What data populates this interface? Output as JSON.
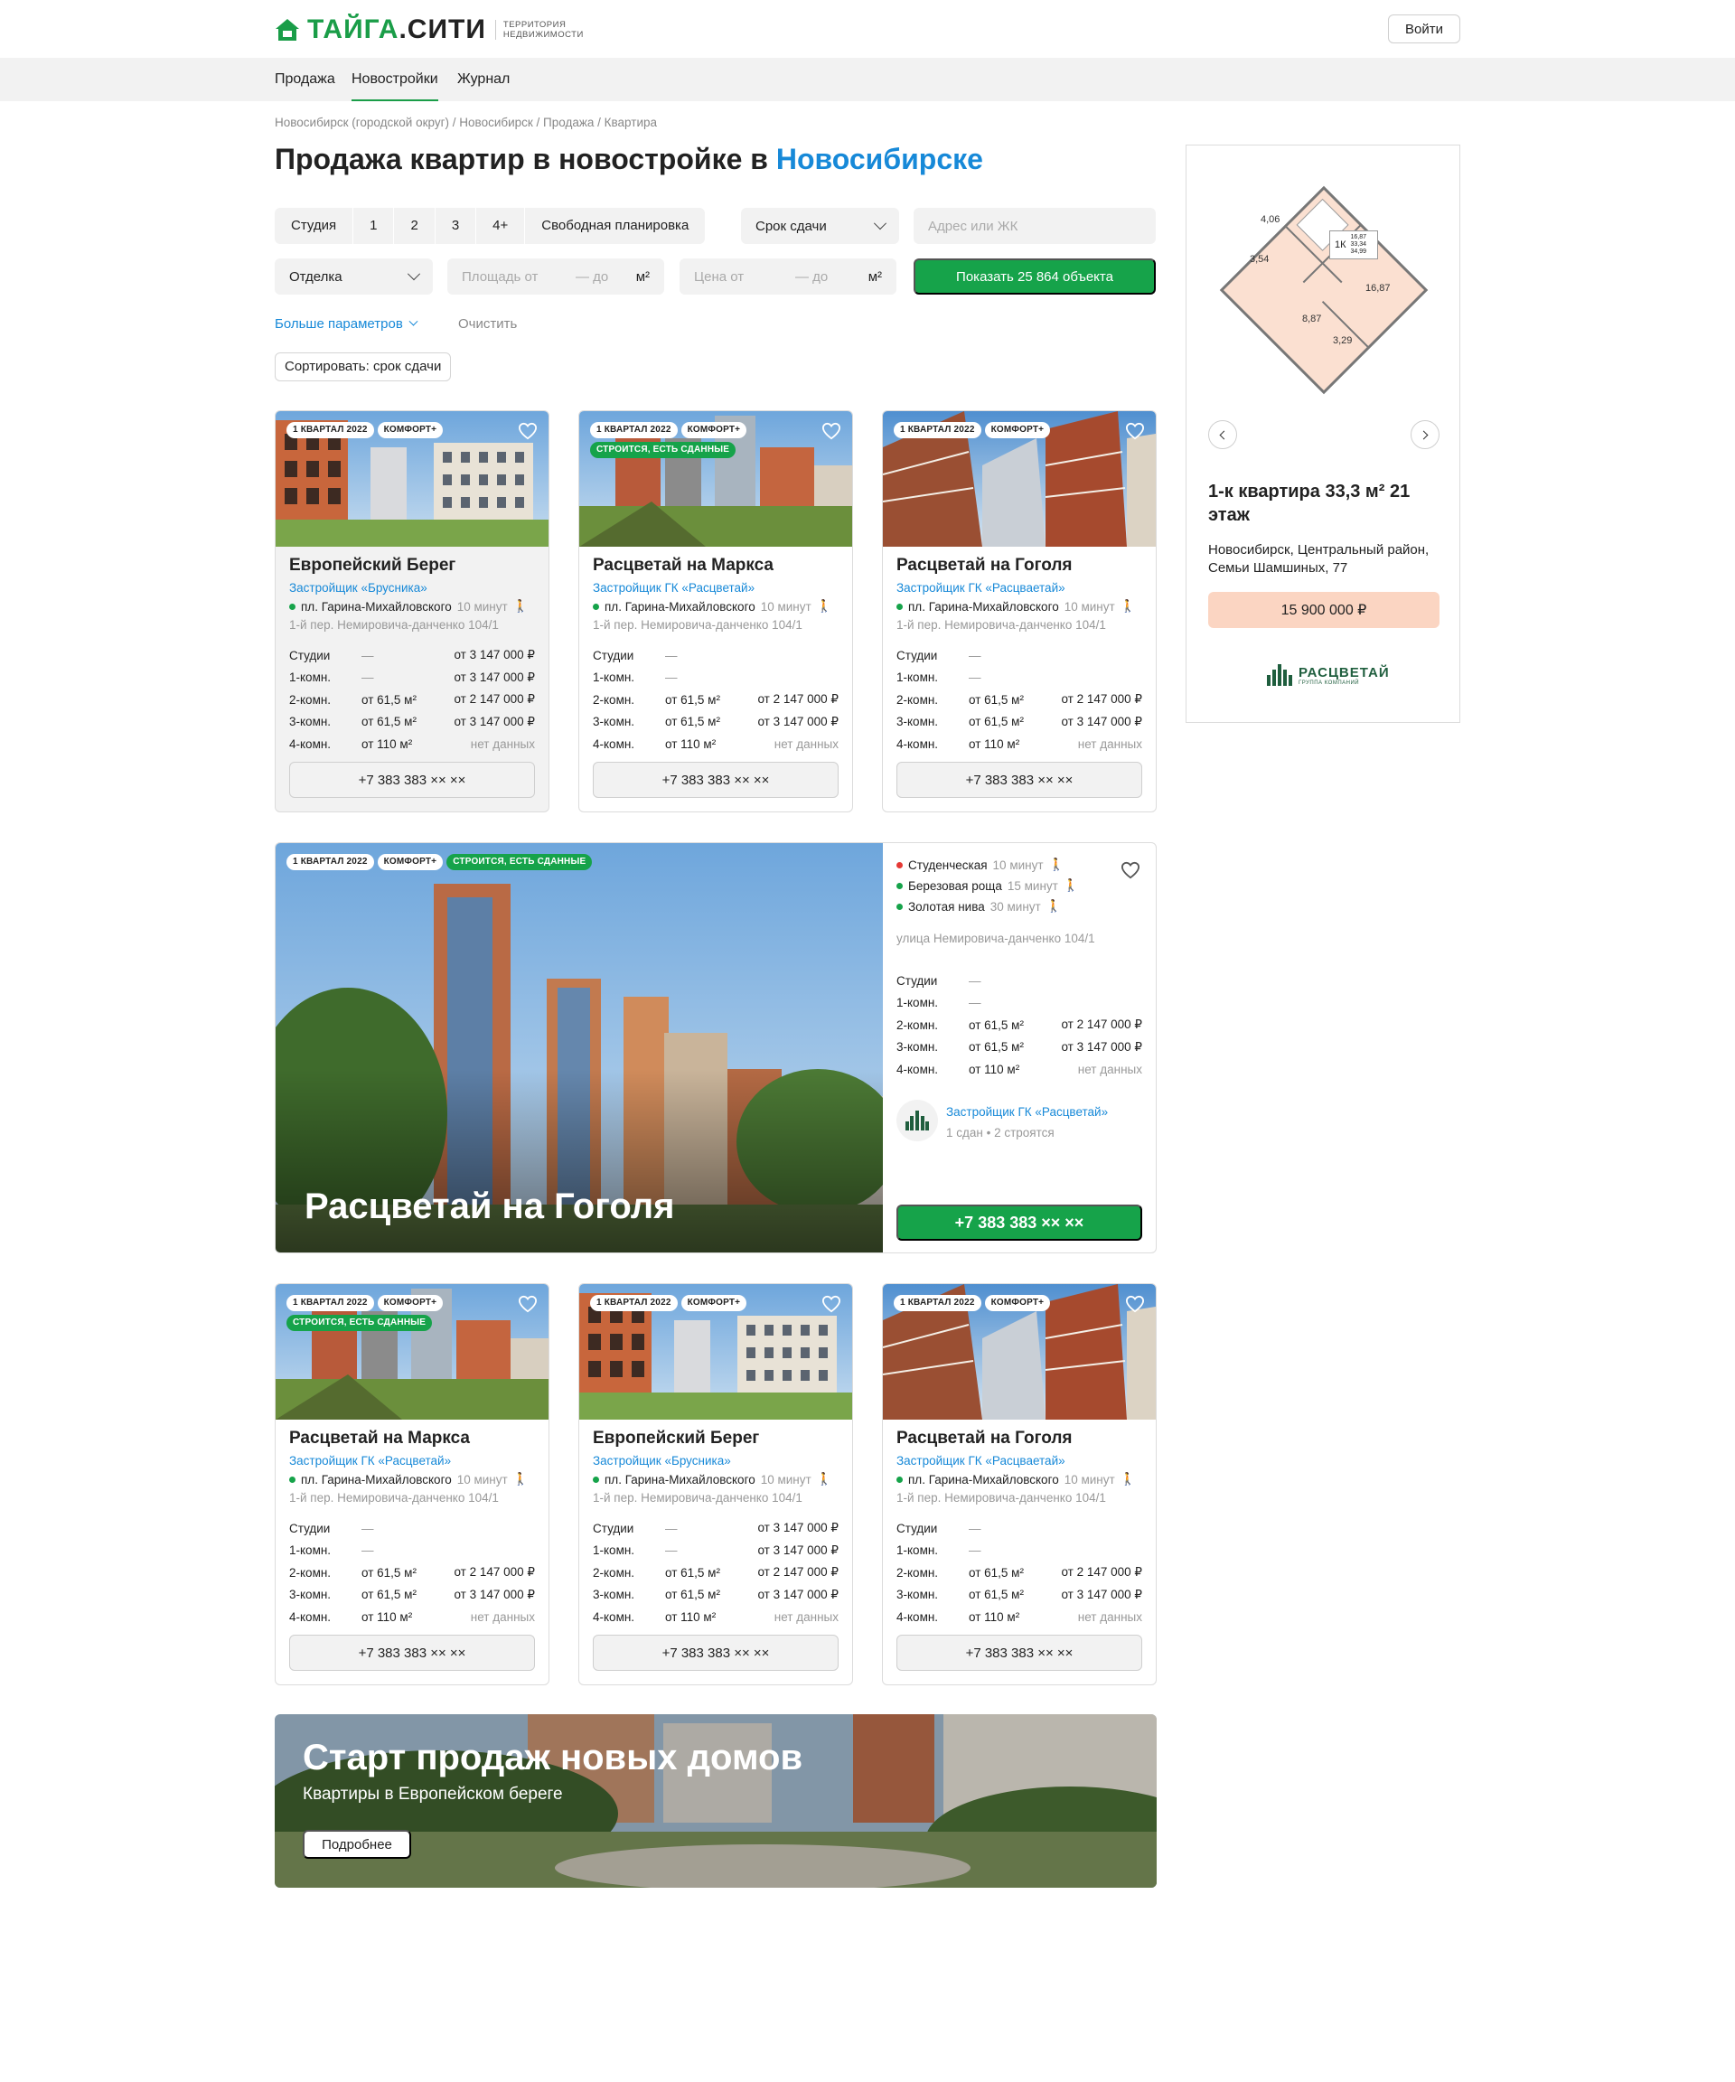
{
  "header": {
    "logo_main": "ТАЙГА",
    "logo_dot": ".СИТИ",
    "logo_tagline_1": "ТЕРРИТОРИЯ",
    "logo_tagline_2": "НЕДВИЖИМОСТИ",
    "login_label": "Войти",
    "brand_color": "#1a9d48"
  },
  "nav": {
    "items": [
      {
        "label": "Продажа",
        "active": false
      },
      {
        "label": "Новостройки",
        "active": true
      },
      {
        "label": "Журнал",
        "active": false
      }
    ]
  },
  "breadcrumb": "Новосибирск (городской округ) / Новосибирск / Продажа / Квартира",
  "title": {
    "prefix": "Продажа квартир в новостройке в",
    "city": "Новосибирске"
  },
  "filters": {
    "rooms": [
      "Студия",
      "1",
      "2",
      "3",
      "4+",
      "Свободная планировка"
    ],
    "deadline": "Срок сдачи",
    "address_placeholder": "Адрес или ЖК",
    "finish": "Отделка",
    "area_from": "Площадь от",
    "area_to": "— до",
    "area_unit": "м²",
    "price_from": "Цена от",
    "price_to": "— до",
    "price_unit": "м²",
    "show_button": "Показать 25 864 объекта",
    "more_params": "Больше параметров",
    "clear": "Очистить",
    "sort": "Сортировать: срок сдачи"
  },
  "cards": [
    {
      "badges": [
        "1 КВАРТАЛ 2022",
        "КОМФОРТ+"
      ],
      "green_badge": "",
      "title": "Европейский Берег",
      "developer": "Застройщик «Брусника»",
      "metro": "пл. Гарина-Михайловского",
      "walk": "10 минут",
      "address": "1-й пер. Немировича-данченко 104/1",
      "rows": [
        {
          "type": "Студии",
          "area": "—",
          "price": "от 3 147 000 ₽"
        },
        {
          "type": "1-комн.",
          "area": "—",
          "price": "от 3 147 000 ₽"
        },
        {
          "type": "2-комн.",
          "area": "от 61,5 м²",
          "price": "от 2 147 000 ₽"
        },
        {
          "type": "3-комн.",
          "area": "от 61,5 м²",
          "price": "от 3 147 000 ₽"
        },
        {
          "type": "4-комн.",
          "area": "от 110 м²",
          "price": "нет данных"
        }
      ],
      "phone": "+7 383 383 ×× ××"
    },
    {
      "badges": [
        "1 КВАРТАЛ 2022",
        "КОМФОРТ+"
      ],
      "green_badge": "СТРОИТСЯ, ЕСТЬ СДАННЫЕ",
      "title": "Расцветай на Маркса",
      "developer": "Застройщик ГК «Расцветай»",
      "metro": "пл. Гарина-Михайловского",
      "walk": "10 минут",
      "address": "1-й пер. Немировича-данченко 104/1",
      "rows": [
        {
          "type": "Студии",
          "area": "—",
          "price": ""
        },
        {
          "type": "1-комн.",
          "area": "—",
          "price": ""
        },
        {
          "type": "2-комн.",
          "area": "от 61,5 м²",
          "price": "от 2 147 000 ₽"
        },
        {
          "type": "3-комн.",
          "area": "от 61,5 м²",
          "price": "от 3 147 000 ₽"
        },
        {
          "type": "4-комн.",
          "area": "от 110 м²",
          "price": "нет данных"
        }
      ],
      "phone": "+7 383 383 ×× ××"
    },
    {
      "badges": [
        "1 КВАРТАЛ 2022",
        "КОМФОРТ+"
      ],
      "green_badge": "",
      "title": "Расцветай на Гоголя",
      "developer": "Застройщик ГК «Расцваетай»",
      "metro": "пл. Гарина-Михайловского",
      "walk": "10 минут",
      "address": "1-й пер. Немировича-данченко 104/1",
      "rows": [
        {
          "type": "Студии",
          "area": "—",
          "price": ""
        },
        {
          "type": "1-комн.",
          "area": "—",
          "price": ""
        },
        {
          "type": "2-комн.",
          "area": "от 61,5 м²",
          "price": "от 2 147 000 ₽"
        },
        {
          "type": "3-комн.",
          "area": "от 61,5 м²",
          "price": "от 3 147 000 ₽"
        },
        {
          "type": "4-комн.",
          "area": "от 110 м²",
          "price": "нет данных"
        }
      ],
      "phone": "+7 383 383 ×× ××"
    },
    {
      "badges": [
        "1 КВАРТАЛ 2022",
        "КОМФОРТ+"
      ],
      "green_badge": "СТРОИТСЯ, ЕСТЬ СДАННЫЕ",
      "title": "Расцветай на Маркса",
      "developer": "Застройщик ГК «Расцветай»",
      "metro": "пл. Гарина-Михайловского",
      "walk": "10 минут",
      "address": "1-й пер. Немировича-данченко 104/1",
      "rows": [
        {
          "type": "Студии",
          "area": "—",
          "price": ""
        },
        {
          "type": "1-комн.",
          "area": "—",
          "price": ""
        },
        {
          "type": "2-комн.",
          "area": "от 61,5 м²",
          "price": "от 2 147 000 ₽"
        },
        {
          "type": "3-комн.",
          "area": "от 61,5 м²",
          "price": "от 3 147 000 ₽"
        },
        {
          "type": "4-комн.",
          "area": "от 110 м²",
          "price": "нет данных"
        }
      ],
      "phone": "+7 383 383 ×× ××"
    },
    {
      "badges": [
        "1 КВАРТАЛ 2022",
        "КОМФОРТ+"
      ],
      "green_badge": "",
      "title": "Европейский Берег",
      "developer": "Застройщик «Брусника»",
      "metro": "пл. Гарина-Михайловского",
      "walk": "10 минут",
      "address": "1-й пер. Немировича-данченко 104/1",
      "rows": [
        {
          "type": "Студии",
          "area": "—",
          "price": "от 3 147 000 ₽"
        },
        {
          "type": "1-комн.",
          "area": "—",
          "price": "от 3 147 000 ₽"
        },
        {
          "type": "2-комн.",
          "area": "от 61,5 м²",
          "price": "от 2 147 000 ₽"
        },
        {
          "type": "3-комн.",
          "area": "от 61,5 м²",
          "price": "от 3 147 000 ₽"
        },
        {
          "type": "4-комн.",
          "area": "от 110 м²",
          "price": "нет данных"
        }
      ],
      "phone": "+7 383 383 ×× ××"
    },
    {
      "badges": [
        "1 КВАРТАЛ 2022",
        "КОМФОРТ+"
      ],
      "green_badge": "",
      "title": "Расцветай на Гоголя",
      "developer": "Застройщик ГК «Расцваетай»",
      "metro": "пл. Гарина-Михайловского",
      "walk": "10 минут",
      "address": "1-й пер. Немировича-данченко 104/1",
      "rows": [
        {
          "type": "Студии",
          "area": "—",
          "price": ""
        },
        {
          "type": "1-комн.",
          "area": "—",
          "price": ""
        },
        {
          "type": "2-комн.",
          "area": "от 61,5 м²",
          "price": "от 2 147 000 ₽"
        },
        {
          "type": "3-комн.",
          "area": "от 61,5 м²",
          "price": "от 3 147 000 ₽"
        },
        {
          "type": "4-комн.",
          "area": "от 110 м²",
          "price": "нет данных"
        }
      ],
      "phone": "+7 383 383 ×× ××"
    }
  ],
  "feature": {
    "badges": [
      "1 КВАРТАЛ 2022",
      "КОМФОРТ+"
    ],
    "green_badge": "СТРОИТСЯ, ЕСТЬ СДАННЫЕ",
    "title": "Расцветай на Гоголя",
    "metros": [
      {
        "name": "Студенческая",
        "walk": "10 минут",
        "line": "red"
      },
      {
        "name": "Березовая роща",
        "walk": "15 минут",
        "line": "green"
      },
      {
        "name": "Золотая нива",
        "walk": "30 минут",
        "line": "green"
      }
    ],
    "address": "улица Немировича-данченко 104/1",
    "rows": [
      {
        "type": "Студии",
        "area": "—",
        "price": ""
      },
      {
        "type": "1-комн.",
        "area": "—",
        "price": ""
      },
      {
        "type": "2-комн.",
        "area": "от 61,5 м²",
        "price": "от 2 147 000 ₽"
      },
      {
        "type": "3-комн.",
        "area": "от 61,5 м²",
        "price": "от 3 147 000 ₽"
      },
      {
        "type": "4-комн.",
        "area": "от 110 м²",
        "price": "нет данных"
      }
    ],
    "developer": "Застройщик ГК «Расцветай»",
    "developer_stats": "1 сдан • 2 строятся",
    "phone": "+7 383 383 ×× ××"
  },
  "banner": {
    "title": "Старт продаж новых домов",
    "subtitle": "Квартиры в Европейском береге",
    "button": "Подробнее"
  },
  "side_ad": {
    "plan_labels": [
      "4,06",
      "1К",
      "16,87",
      "33,34",
      "34,99",
      "3,54",
      "16,87",
      "8,87",
      "3,29"
    ],
    "title": "1-к квартира 33,3 м² 21 этаж",
    "address": "Новосибирск, Центральный район, Семьи Шамшиных, 77",
    "price": "15 900 000 ₽",
    "logo_text": "РАСЦВЕТАЙ",
    "logo_sub": "ГРУППА КОМПАНИЙ"
  }
}
